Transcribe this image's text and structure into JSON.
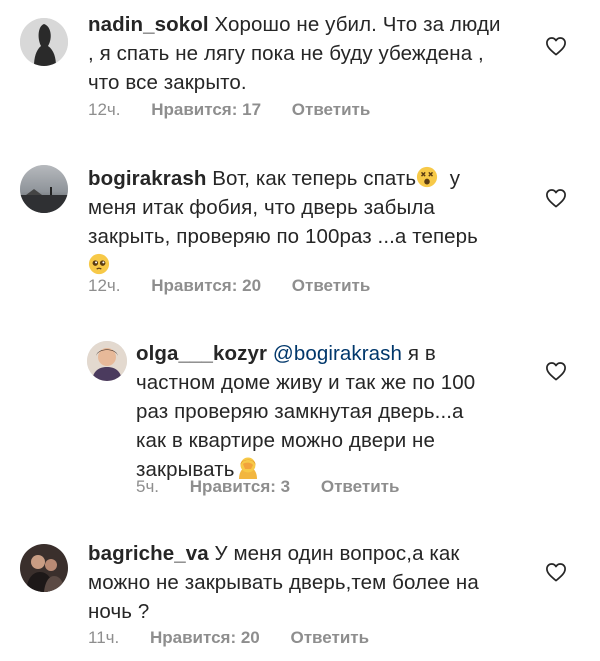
{
  "comments": [
    {
      "username": "nadin_sokol",
      "text_parts": [
        "Хорошо не убил. Что за люди",
        ", я спать не лягу пока не буду убеждена ,",
        "что все закрыто."
      ],
      "time": "12ч.",
      "likes": "Нравится: 17",
      "reply": "Ответить"
    },
    {
      "username": "bogirakrash",
      "text_parts": [
        "Вот, как теперь спать",
        "у",
        "меня итак фобия, что дверь забыла",
        "закрыть, проверяю по 100раз ...а теперь"
      ],
      "emoji1": "dizzy-face-emoji",
      "emoji2": "pleading-face-emoji",
      "time": "12ч.",
      "likes": "Нравится: 20",
      "reply": "Ответить"
    },
    {
      "username": "olga___kozyr",
      "mention": "@bogirakrash",
      "text_parts": [
        "я в",
        "частном доме живу и так же по 100",
        "раз проверяю замкнутая дверь...а",
        "как в квартире можно двери не",
        "закрывать"
      ],
      "emoji1": "facepalm-woman-emoji",
      "time": "5ч.",
      "likes": "Нравится: 3",
      "reply": "Ответить"
    },
    {
      "username": "bagriche_va",
      "text_parts": [
        "У меня один вопрос,а как",
        "можно не закрывать дверь,тем более на",
        "ночь ?"
      ],
      "time": "11ч.",
      "likes": "Нравится: 20",
      "reply": "Ответить"
    }
  ],
  "icons": {
    "like": "heart-outline-icon"
  },
  "colors": {
    "text": "#262626",
    "meta": "#8e8e8e",
    "mention": "#00376b"
  }
}
